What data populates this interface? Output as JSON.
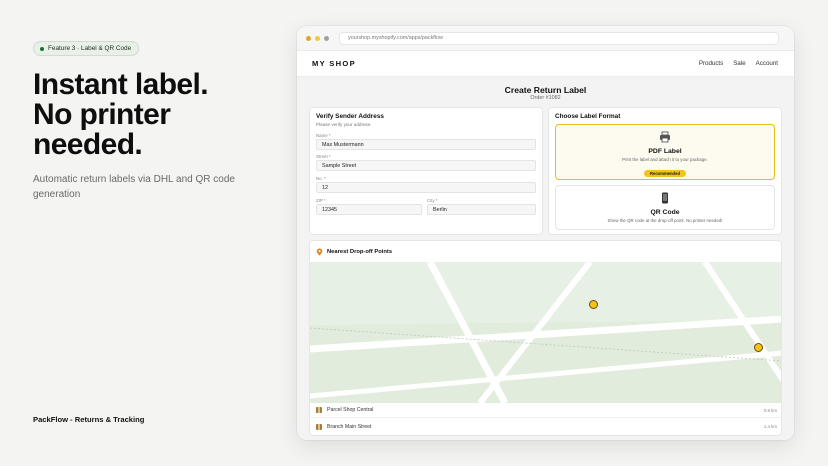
{
  "feature_badge": "Feature 3 · Label & QR Code",
  "headline": [
    "Instant label.",
    "No printer",
    "needed."
  ],
  "subtitle": "Automatic return labels via DHL and QR code generation",
  "brand_footer": "PackFlow - Returns & Tracking",
  "browser": {
    "url": "yourshop.myshopify.com/apps/packflow",
    "traffic_lights": [
      "#e0a42b",
      "#f0c83a",
      "#9aa3a0"
    ]
  },
  "shop": {
    "logo": "MY SHOP",
    "nav": [
      "Products",
      "Sale",
      "Account"
    ]
  },
  "page": {
    "title": "Create Return Label",
    "order": "Order #1082"
  },
  "sender": {
    "title": "Verify Sender Address",
    "hint": "Please verify your address.",
    "fields": {
      "name": {
        "label": "Name *",
        "value": "Max Mustermann"
      },
      "street": {
        "label": "Street *",
        "value": "Sample Street"
      },
      "no": {
        "label": "No. *",
        "value": "12"
      },
      "zip": {
        "label": "ZIP *",
        "value": "12345"
      },
      "city": {
        "label": "City *",
        "value": "Berlin"
      }
    }
  },
  "format": {
    "title": "Choose Label Format",
    "pdf": {
      "name": "PDF Label",
      "desc": "Print the label and attach it to your package.",
      "badge": "Recommended",
      "icon": "printer-icon"
    },
    "qr": {
      "name": "QR Code",
      "desc": "Show the QR code at the drop-off point. No printer needed!",
      "icon": "phone-icon"
    }
  },
  "dropoff": {
    "title": "Nearest Drop-off Points",
    "locations": [
      {
        "name": "Parcel Shop Central",
        "distance": "0.8 km"
      },
      {
        "name": "Branch Main Street",
        "distance": "1.4 km"
      }
    ]
  },
  "colors": {
    "accent_yellow": "#f2c417",
    "selected_border": "#e6be1e",
    "map_green": "#e7f0e4"
  }
}
